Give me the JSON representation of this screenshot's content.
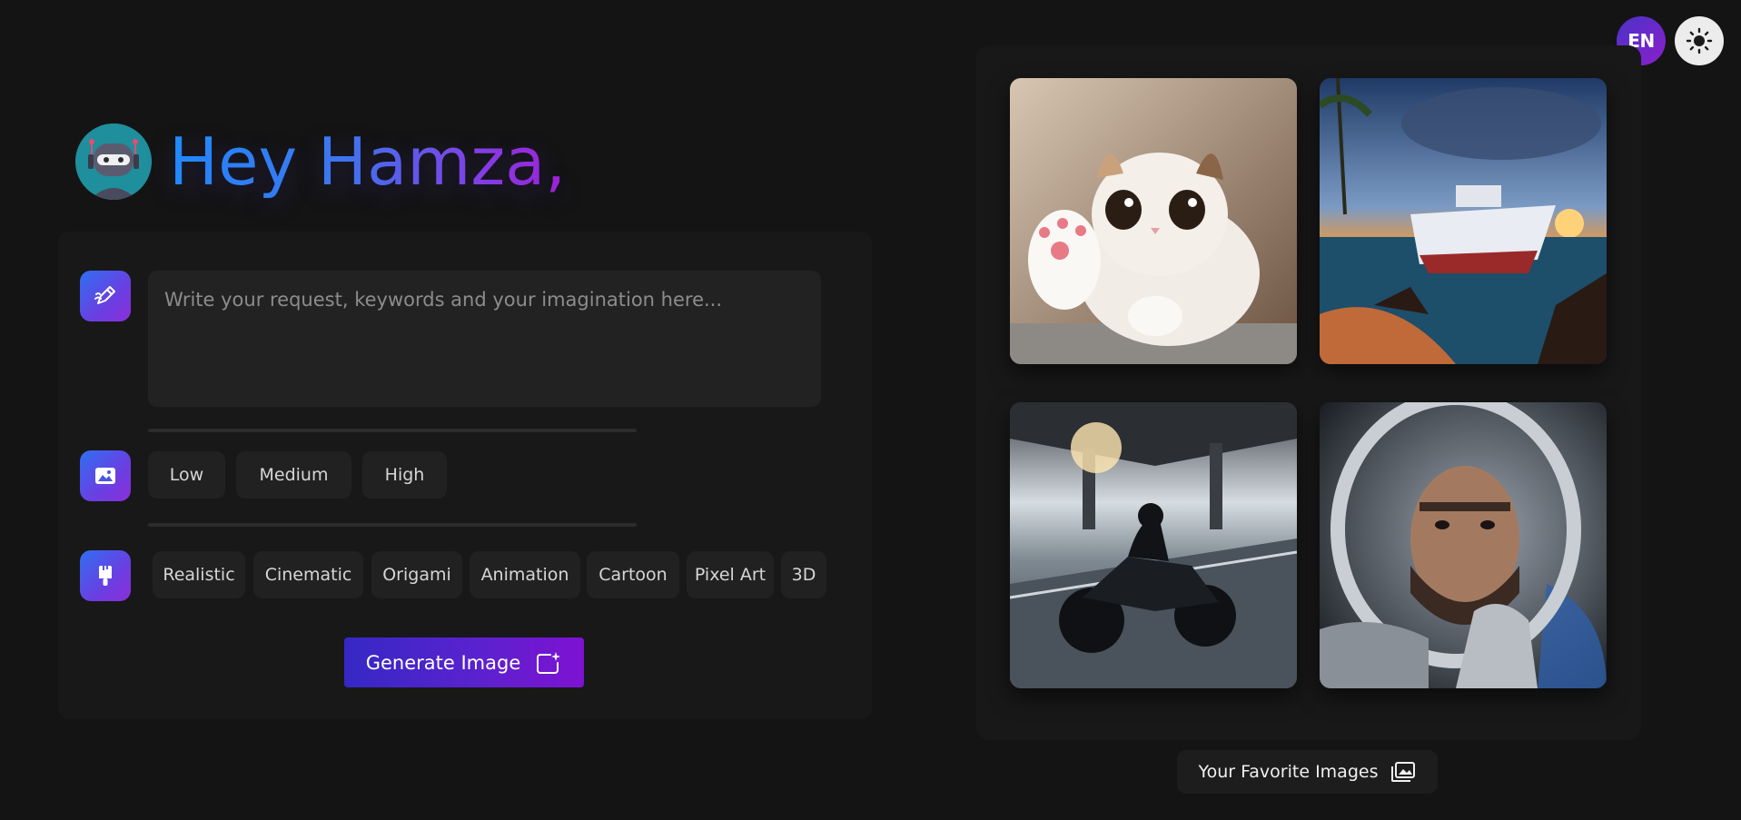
{
  "header": {
    "language_label": "EN",
    "theme_toggle_icon": "sun-icon"
  },
  "greeting": {
    "text": "Hey Hamza,",
    "avatar_icon": "robot-avatar-icon",
    "gradient_colors": [
      "#1e8fff",
      "#8a3de6",
      "#a021d6"
    ]
  },
  "form": {
    "prompt": {
      "icon": "pen-sparkle-icon",
      "placeholder": "Write your request, keywords and your imagination here...",
      "value": ""
    },
    "quality": {
      "icon": "image-icon",
      "options": [
        "Low",
        "Medium",
        "High"
      ]
    },
    "style": {
      "icon": "brush-icon",
      "options": [
        "Realistic",
        "Cinematic",
        "Origami",
        "Animation",
        "Cartoon",
        "Pixel Art",
        "3D"
      ]
    },
    "generate_label": "Generate Image",
    "generate_icon": "image-sparkle-icon",
    "accent_gradient": [
      "#3528c4",
      "#7e12d2"
    ]
  },
  "gallery": {
    "images": [
      {
        "subject": "cat waving paw"
      },
      {
        "subject": "cruise ship at sunset beach"
      },
      {
        "subject": "motorcycle under bridge"
      },
      {
        "subject": "astronaut portrait"
      }
    ],
    "favorites_label": "Your Favorite Images",
    "favorites_icon": "images-icon"
  }
}
